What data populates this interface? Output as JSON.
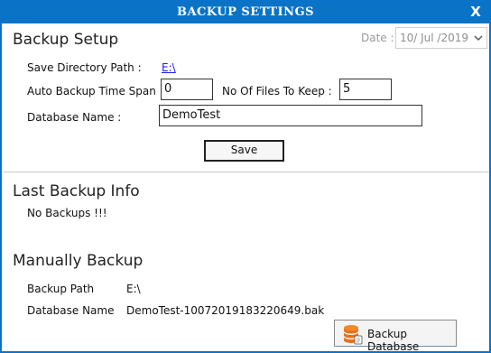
{
  "window": {
    "title": "BACKUP SETTINGS",
    "close_label": "X"
  },
  "setup": {
    "heading": "Backup Setup",
    "date_label": "Date :",
    "date_value": "10/ Jul /2019",
    "save_dir_label": "Save Directory Path :",
    "save_dir_value": "E:\\",
    "time_span_label": "Auto Backup Time Span :",
    "time_span_value": "0",
    "files_keep_label": "No Of Files To Keep :",
    "files_keep_value": "5",
    "db_name_label": "Database Name :",
    "db_name_value": "DemoTest",
    "save_button": "Save"
  },
  "last_backup": {
    "heading": "Last Backup Info",
    "status": "No Backups !!!"
  },
  "manual": {
    "heading": "Manually Backup",
    "path_label": "Backup Path",
    "path_value": "E:\\",
    "db_label": "Database Name",
    "db_value": "DemoTest-10072019183220649.bak",
    "backup_button": "Backup Database",
    "backup_icon": "database-icon"
  },
  "colors": {
    "titlebar": "#0b73c6",
    "link": "#1a1aee",
    "icon_orange": "#e8711c"
  }
}
